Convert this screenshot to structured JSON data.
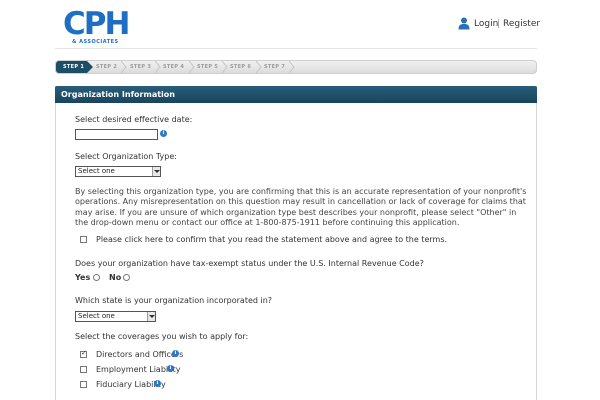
{
  "header": {
    "logo_main": "CPH",
    "logo_sub": "& ASSOCIATES",
    "login_label": "Login",
    "separator": "|",
    "register_label": "Register"
  },
  "steps": [
    "STEP 1",
    "STEP 2",
    "STEP 3",
    "STEP 4",
    "STEP 5",
    "STEP 6",
    "STEP 7"
  ],
  "active_step": 1,
  "panel": {
    "title": "Organization Information"
  },
  "form": {
    "effective_date_label": "Select desired effective date:",
    "effective_date_value": "",
    "org_type_label": "Select Organization Type:",
    "org_type_value": "Select one",
    "disclaimer": "By selecting this organization type, you are confirming that this is an accurate representation of your nonprofit's operations. Any misrepresentation on this question may result in cancellation or lack of coverage for claims that may arise. If you are unsure of which organization type best describes your nonprofit, please select \"Other\" in the drop-down menu or contact our office at 1-800-875-1911 before continuing this application.",
    "confirm_label": "Please click here to confirm that you read the statement above and agree to the terms.",
    "tax_exempt_label": "Does your organization have tax-exempt status under the U.S. Internal Revenue Code?",
    "yes_label": "Yes",
    "no_label": "No",
    "state_label": "Which state is your organization incorporated in?",
    "state_value": "Select one",
    "coverages_label": "Select the coverages you wish to apply for:",
    "coverages": [
      {
        "label": "Directors and Officers",
        "checked": true
      },
      {
        "label": "Employment Liability",
        "checked": false
      },
      {
        "label": "Fiduciary Liability",
        "checked": false
      }
    ]
  },
  "colors": {
    "brand_blue": "#1e6fc4",
    "header_navy": "#1d4e67",
    "info_blue": "#2b78c5"
  },
  "icons": {
    "user": "user-icon",
    "info": "info-icon"
  }
}
